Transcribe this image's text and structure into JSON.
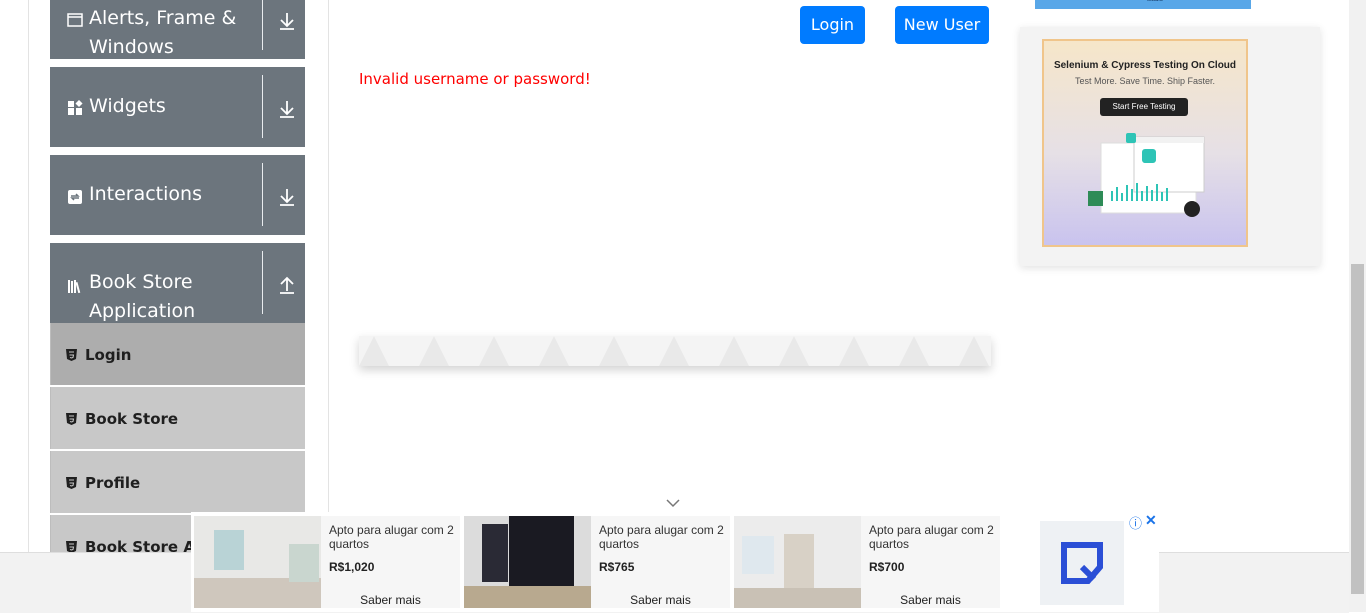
{
  "sidebar": {
    "groups": [
      {
        "label": "Alerts, Frame & Windows",
        "icon": "window-icon",
        "state": "collapsed"
      },
      {
        "label": "Widgets",
        "icon": "widgets-icon",
        "state": "collapsed"
      },
      {
        "label": "Interactions",
        "icon": "interactions-icon",
        "state": "collapsed"
      },
      {
        "label": "Book Store Application",
        "icon": "books-icon",
        "state": "expanded"
      }
    ],
    "book_store_items": [
      {
        "label": "Login",
        "active": true
      },
      {
        "label": "Book Store",
        "active": false
      },
      {
        "label": "Profile",
        "active": false
      },
      {
        "label": "Book Store API",
        "active": false
      }
    ]
  },
  "main": {
    "login_button": "Login",
    "new_user_button": "New User",
    "error_message": "Invalid username or password!"
  },
  "right_ad": {
    "top_banner_text": "studio",
    "title": "Selenium & Cypress Testing On Cloud",
    "subtitle": "Test More. Save Time. Ship Faster.",
    "cta": "Start Free Testing"
  },
  "bottom_ad": {
    "cards": [
      {
        "title": "Apto para alugar com 2 quartos",
        "price": "R$1,020",
        "link": "Saber mais"
      },
      {
        "title": "Apto para alugar com 2 quartos",
        "price": "R$765",
        "link": "Saber mais"
      },
      {
        "title": "Apto para alugar com 2 quartos",
        "price": "R$700",
        "link": "Saber mais"
      }
    ],
    "info_glyph": "ⓘ",
    "close_glyph": "✕"
  },
  "colors": {
    "primary": "#007bff",
    "sidebar_group": "#6c757d",
    "error": "#ff0000"
  }
}
